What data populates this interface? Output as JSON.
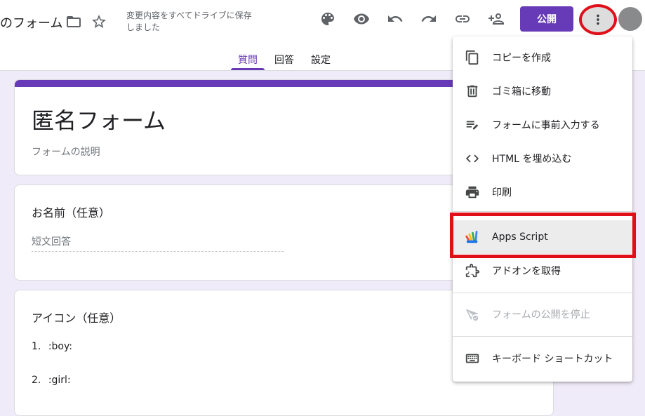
{
  "header": {
    "title": "のフォーム",
    "save_status": "変更内容をすべてドライブに保存しました",
    "publish_label": "公開"
  },
  "tabs": [
    {
      "label": "質問",
      "active": true
    },
    {
      "label": "回答",
      "active": false
    },
    {
      "label": "設定",
      "active": false
    }
  ],
  "form": {
    "title": "匿名フォーム",
    "description": "フォームの説明",
    "questions": [
      {
        "title": "お名前（任意）",
        "answer_placeholder": "短文回答"
      },
      {
        "title": "アイコン（任意）",
        "options": [
          {
            "index": "1.",
            "label": ":boy:"
          },
          {
            "index": "2.",
            "label": ":girl:"
          }
        ]
      }
    ]
  },
  "menu": {
    "items": [
      {
        "label": "コピーを作成",
        "icon": "copy-icon"
      },
      {
        "label": "ゴミ箱に移動",
        "icon": "trash-icon"
      },
      {
        "label": "フォームに事前入力する",
        "icon": "prefill-icon"
      },
      {
        "label": "HTML を埋め込む",
        "icon": "code-icon"
      },
      {
        "label": "印刷",
        "icon": "print-icon"
      },
      {
        "label": "Apps Script",
        "icon": "apps-script-icon"
      },
      {
        "label": "アドオンを取得",
        "icon": "addon-icon"
      },
      {
        "label": "フォームの公開を停止",
        "icon": "unpublish-icon",
        "disabled": true
      },
      {
        "label": "キーボード ショートカット",
        "icon": "keyboard-icon"
      }
    ]
  },
  "colors": {
    "accent": "#673ab7",
    "highlight_outline": "#e0101a",
    "background": "#f0ebf8"
  }
}
